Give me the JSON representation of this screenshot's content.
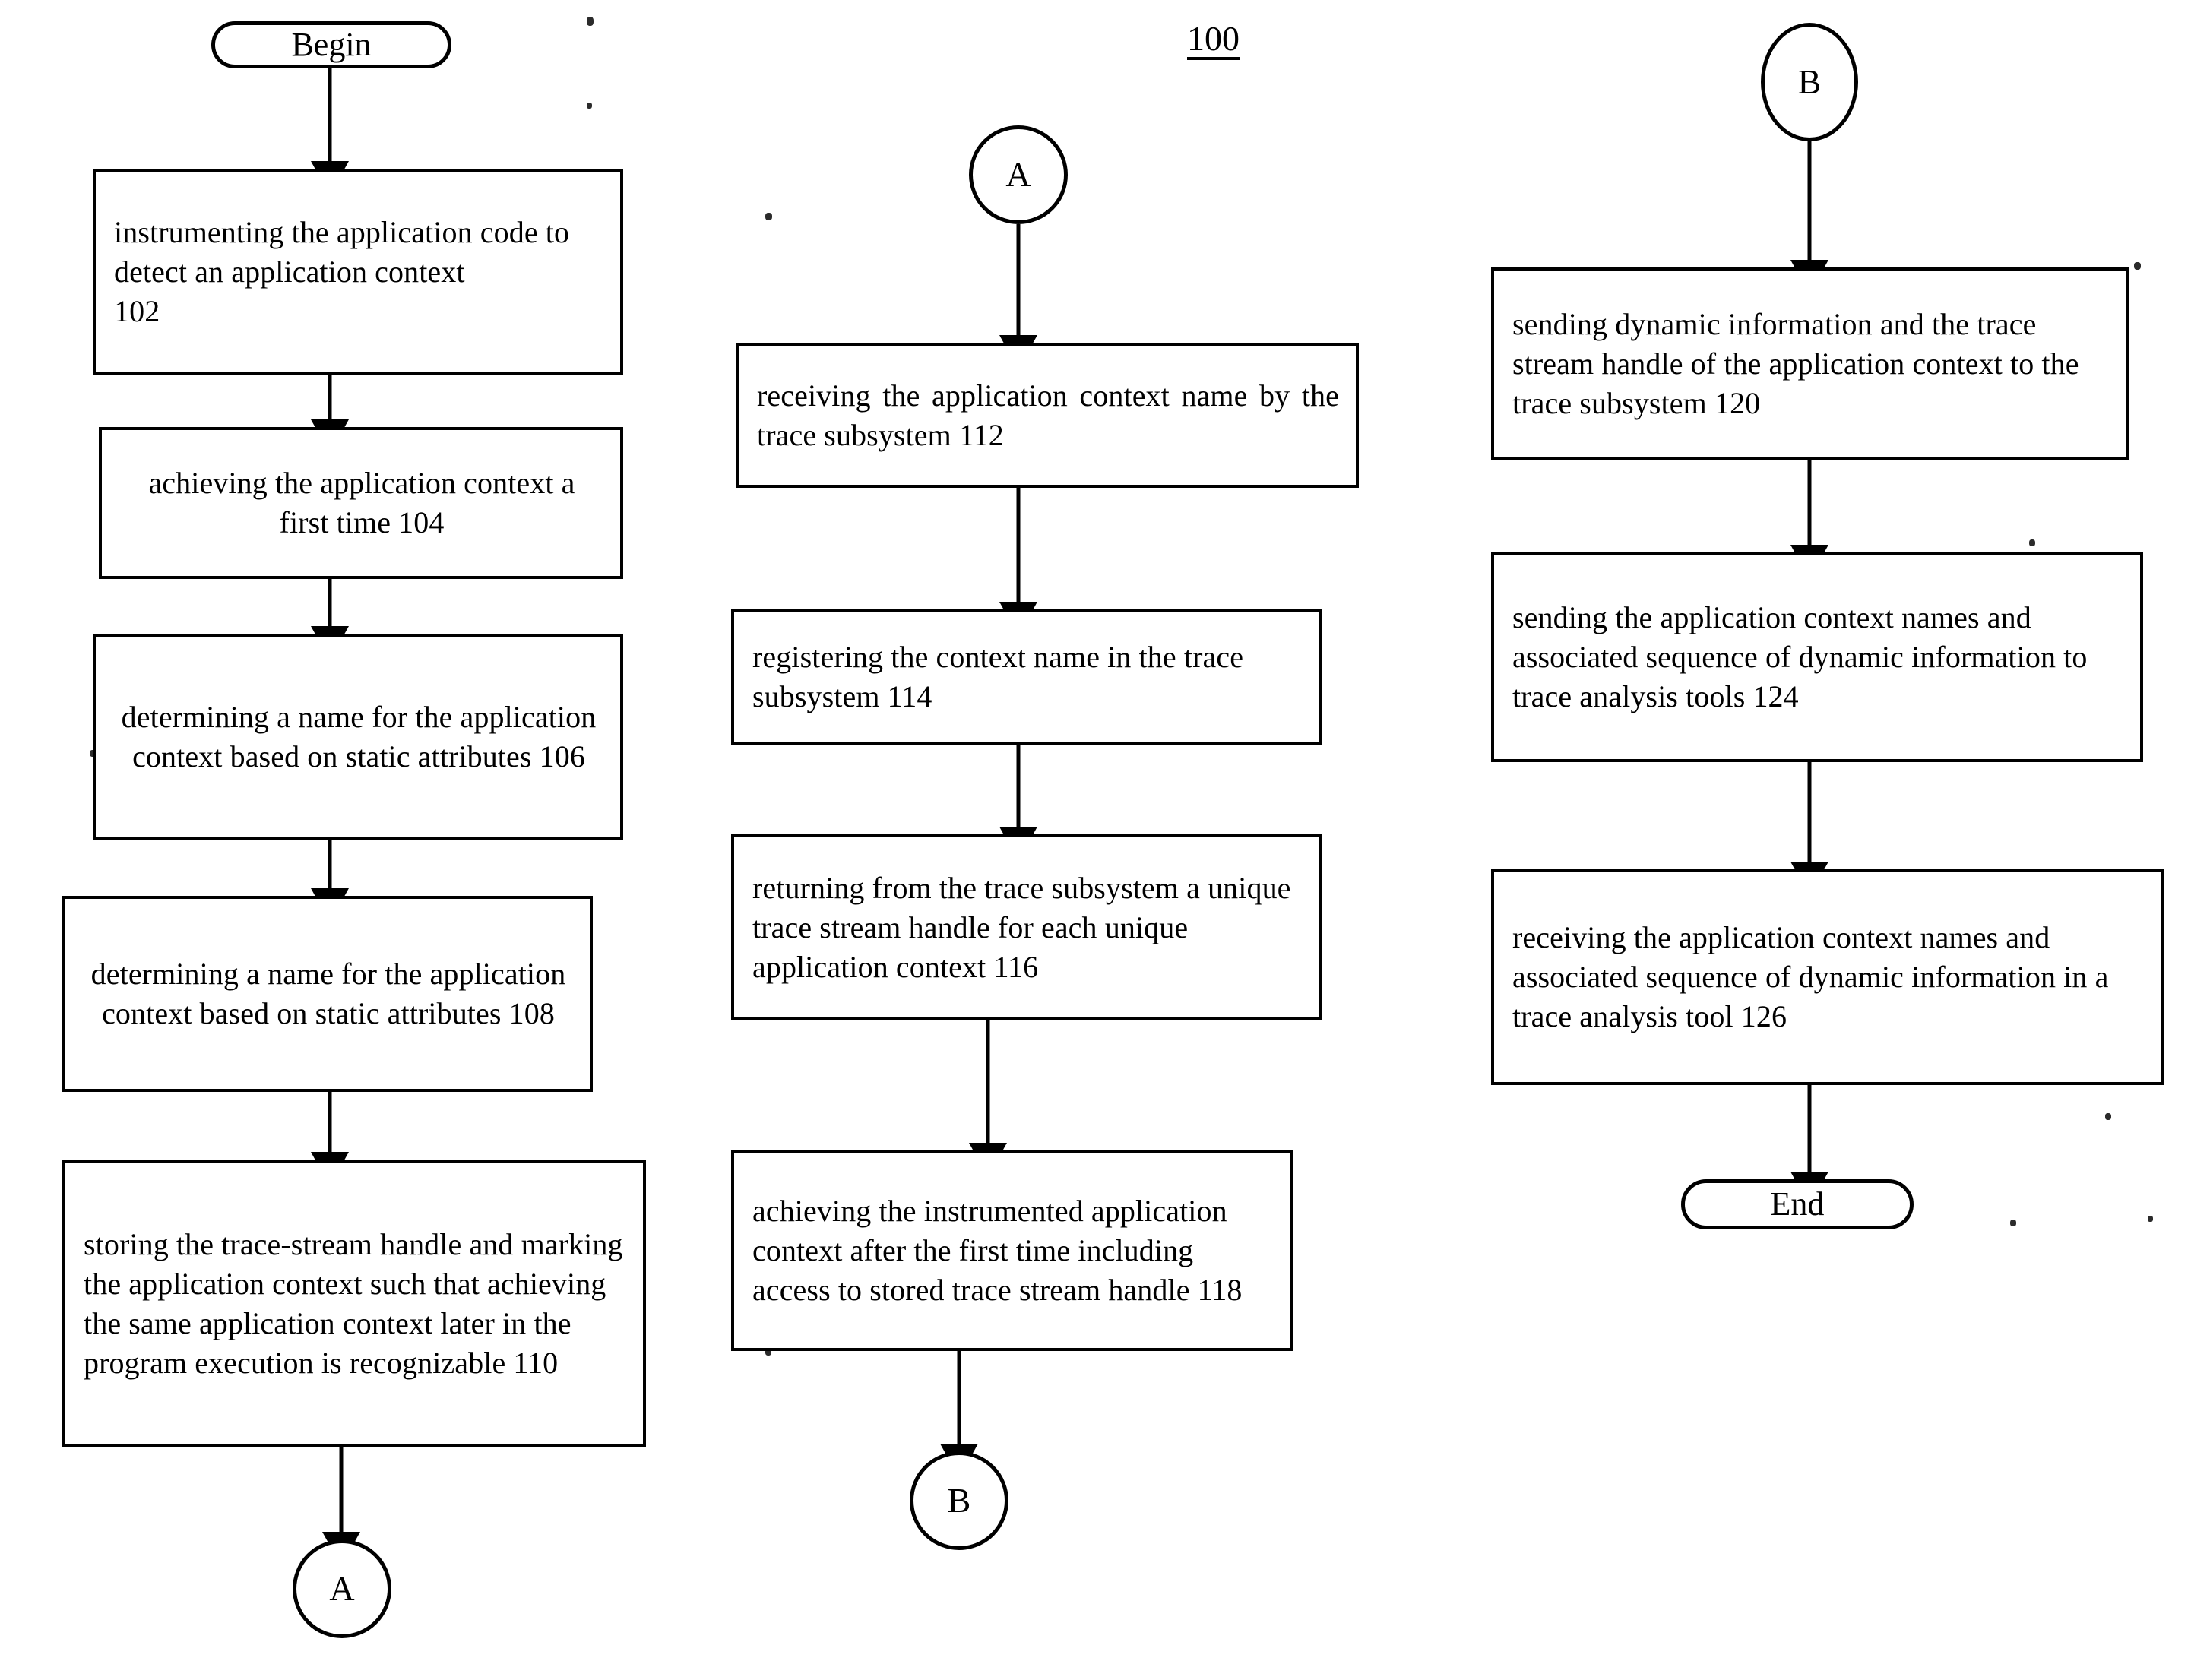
{
  "figure": {
    "label": "100",
    "title_note": ""
  },
  "columns": [
    {
      "id": "column-1",
      "nodes": [
        {
          "id": "begin",
          "shape": "terminator",
          "text": "Begin"
        },
        {
          "id": "step-102",
          "shape": "process",
          "align": "left",
          "text": "instrumenting the application code to detect an application context\n102"
        },
        {
          "id": "step-104",
          "shape": "process",
          "align": "center",
          "text": "achieving the application context a first time 104"
        },
        {
          "id": "step-106",
          "shape": "process",
          "align": "center",
          "text": "determining a name for the application context based on static attributes 106"
        },
        {
          "id": "step-108",
          "shape": "process",
          "align": "center",
          "text": "determining a name for the application context based on static attributes 108"
        },
        {
          "id": "step-110",
          "shape": "process",
          "align": "left",
          "text": "storing the trace-stream handle and marking the application context such that achieving the same application context later in the program execution is recognizable 110"
        },
        {
          "id": "connector-a-out",
          "shape": "connector",
          "text": "A"
        }
      ]
    },
    {
      "id": "column-2",
      "nodes": [
        {
          "id": "connector-a-in",
          "shape": "connector",
          "text": "A"
        },
        {
          "id": "step-112",
          "shape": "process",
          "align": "justify",
          "text": "receiving the application context name by the trace subsystem 112"
        },
        {
          "id": "step-114",
          "shape": "process",
          "align": "left",
          "text": "registering the context name in the trace subsystem 114"
        },
        {
          "id": "step-116",
          "shape": "process",
          "align": "left",
          "text": "returning from the trace subsystem a unique trace stream handle for each unique application context      116"
        },
        {
          "id": "step-118",
          "shape": "process",
          "align": "left",
          "text": "achieving the instrumented application context after the first time including access to stored trace stream handle 118"
        },
        {
          "id": "connector-b-out",
          "shape": "connector",
          "text": "B"
        }
      ]
    },
    {
      "id": "column-3",
      "nodes": [
        {
          "id": "connector-b-in",
          "shape": "connector",
          "text": "B"
        },
        {
          "id": "step-120",
          "shape": "process",
          "align": "left",
          "text": "sending dynamic information and the trace stream handle of the application context to the trace subsystem 120"
        },
        {
          "id": "step-124",
          "shape": "process",
          "align": "left",
          "text": "sending the application context names and associated sequence of dynamic information to trace analysis tools 124"
        },
        {
          "id": "step-126",
          "shape": "process",
          "align": "left",
          "text": "receiving the application context names and associated sequence of dynamic information in a trace analysis tool 126"
        },
        {
          "id": "end",
          "shape": "terminator",
          "text": "End"
        }
      ]
    }
  ],
  "flow_edges": [
    {
      "from": "begin",
      "to": "step-102"
    },
    {
      "from": "step-102",
      "to": "step-104"
    },
    {
      "from": "step-104",
      "to": "step-106"
    },
    {
      "from": "step-106",
      "to": "step-108"
    },
    {
      "from": "step-108",
      "to": "step-110"
    },
    {
      "from": "step-110",
      "to": "connector-a-out"
    },
    {
      "from": "connector-a-in",
      "to": "step-112"
    },
    {
      "from": "step-112",
      "to": "step-114"
    },
    {
      "from": "step-114",
      "to": "step-116"
    },
    {
      "from": "step-116",
      "to": "step-118"
    },
    {
      "from": "step-118",
      "to": "connector-b-out"
    },
    {
      "from": "connector-b-in",
      "to": "step-120"
    },
    {
      "from": "step-120",
      "to": "step-124"
    },
    {
      "from": "step-124",
      "to": "step-126"
    },
    {
      "from": "step-126",
      "to": "end"
    }
  ],
  "colors": {
    "stroke": "#000000",
    "fill": "#ffffff",
    "text": "#000000"
  }
}
